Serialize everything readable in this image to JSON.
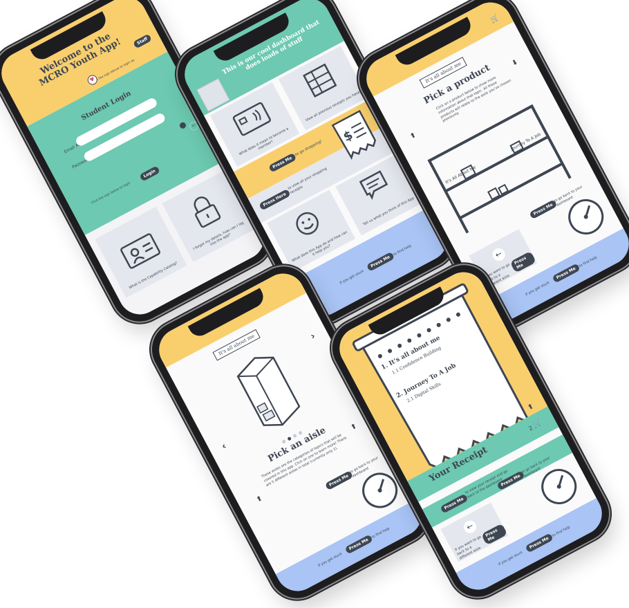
{
  "login": {
    "title": "Welcome to the MCRO Youth App!",
    "staff_button": "Staff",
    "staff_hint": "Click the sign above to login as",
    "student_login": "Student Login",
    "email_label": "Email Address",
    "password_label": "Password",
    "login_hint": "Click the sign below to login",
    "login_button": "Login",
    "tile1_caption": "What is the Capability Catalog?",
    "tile2_caption": "I forgot my details, how can I log into the app?"
  },
  "dashboard": {
    "title": "This is our cool dashboard that does loads of stuff",
    "tile1_caption": "What does it mean to become a member?",
    "tile2_caption": "View all previous receipts you have",
    "shop_button": "Press Me",
    "shop_text": "to go shopping!",
    "receipts_button": "Press Here",
    "receipts_text": "to view all your shopping receipts",
    "tile3_caption": "What does this App do and how can it help you?",
    "tile4_caption": "Tell us what you think of this App",
    "help_prefix": "If you get stuck",
    "help_button": "Press Me",
    "help_suffix": "to find help"
  },
  "product": {
    "sign": "It's all about me",
    "title": "Pick a product",
    "instructions": "Click on a product below to show more information about that topic. All these products will relate to the aisle you've chosen previously.",
    "shelf_label1": "It's All About Me",
    "shelf_label2": "Journey To A Job",
    "back_caption": "If you want to go back to a different aisle",
    "back_button": "Press Me",
    "dash_button": "Press Me",
    "dash_text": "to go back to your dashboard",
    "help_prefix": "If you get stuck",
    "help_button": "Press Me",
    "help_suffix": "to find help"
  },
  "aisle": {
    "sign": "It's all about me",
    "title": "Pick an aisle",
    "description": "These aisles are the categories of topics that will be covered in this app. Click on one to learn more! There are 5 different aisles in total (currently only 1).",
    "dash_button": "Press Me",
    "dash_text": "to go back to your dashboard",
    "help_prefix": "If you get stuck",
    "help_button": "Press Me",
    "help_suffix": "to find help"
  },
  "receipt": {
    "line1": "1. It's all about me",
    "line1a": "1.1 Confidence Building",
    "line2": "2. Journey To A Job",
    "line2a": "2.1 Digital Skills",
    "title": "Your Receipt",
    "cart_count": "2",
    "view_button": "Press Me",
    "view_text": "to view your receipt and go back to the dashboard",
    "aisle_caption": "If you want to go back to a different aisle",
    "aisle_button": "Press Me",
    "dash_button": "Press Me",
    "dash_text": "to go back to your dashboard",
    "help_prefix": "If you get stuck",
    "help_button": "Press Me",
    "help_suffix": "to find help"
  },
  "colors": {
    "yellow": "#f9cf6e",
    "teal": "#6dc9b1",
    "blue": "#a9c4f5",
    "ink": "#3e4652",
    "tile": "#e4e7ee"
  }
}
